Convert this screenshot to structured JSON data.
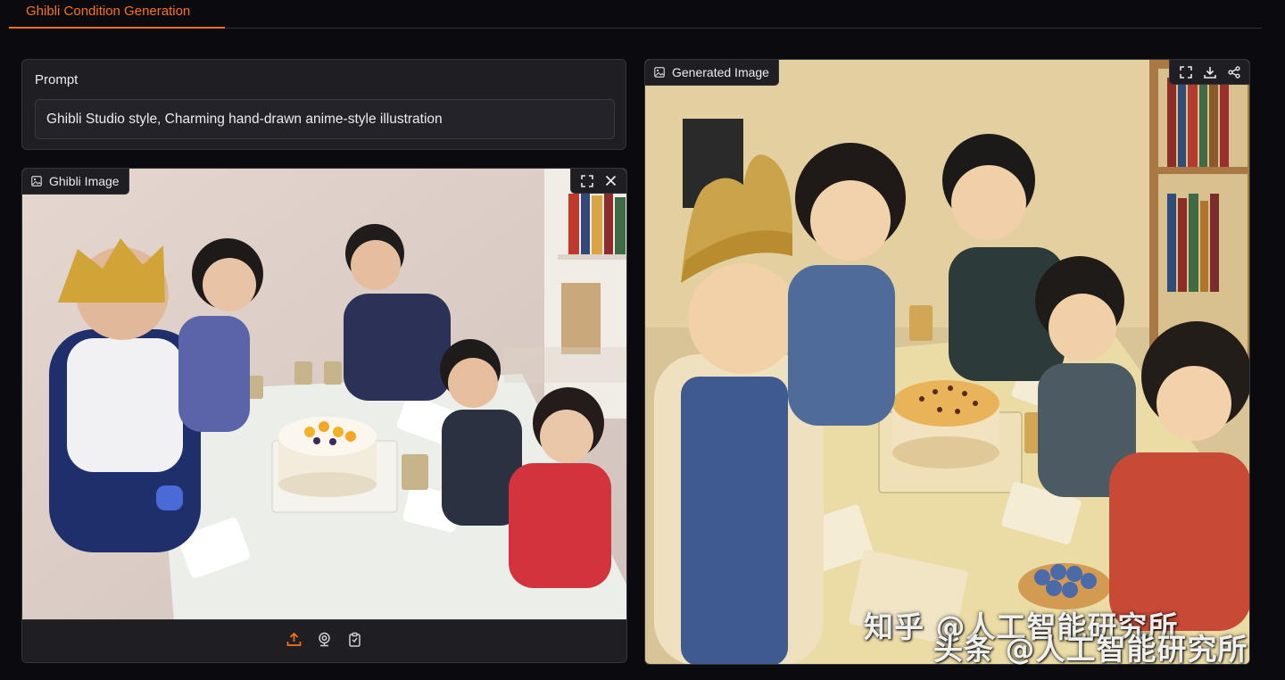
{
  "tabs": [
    {
      "label": "Ghibli Condition Generation",
      "active": true
    }
  ],
  "prompt": {
    "label": "Prompt",
    "value": "Ghibli Studio style, Charming hand-drawn anime-style illustration"
  },
  "input_image": {
    "label": "Ghibli Image",
    "toolbar": [
      "fullscreen-icon",
      "close-icon"
    ],
    "source_toolbar": [
      "upload-icon",
      "webcam-icon",
      "clipboard-icon"
    ]
  },
  "output_image": {
    "label": "Generated Image",
    "toolbar": [
      "fullscreen-icon",
      "download-icon",
      "share-icon"
    ]
  },
  "watermarks": [
    "知乎 @人工智能研究所",
    "头条 @人工智能研究所"
  ],
  "colors": {
    "accent": "#f97316",
    "background": "#0b0b0f",
    "panel": "#1e1e23",
    "border": "#34343b"
  }
}
